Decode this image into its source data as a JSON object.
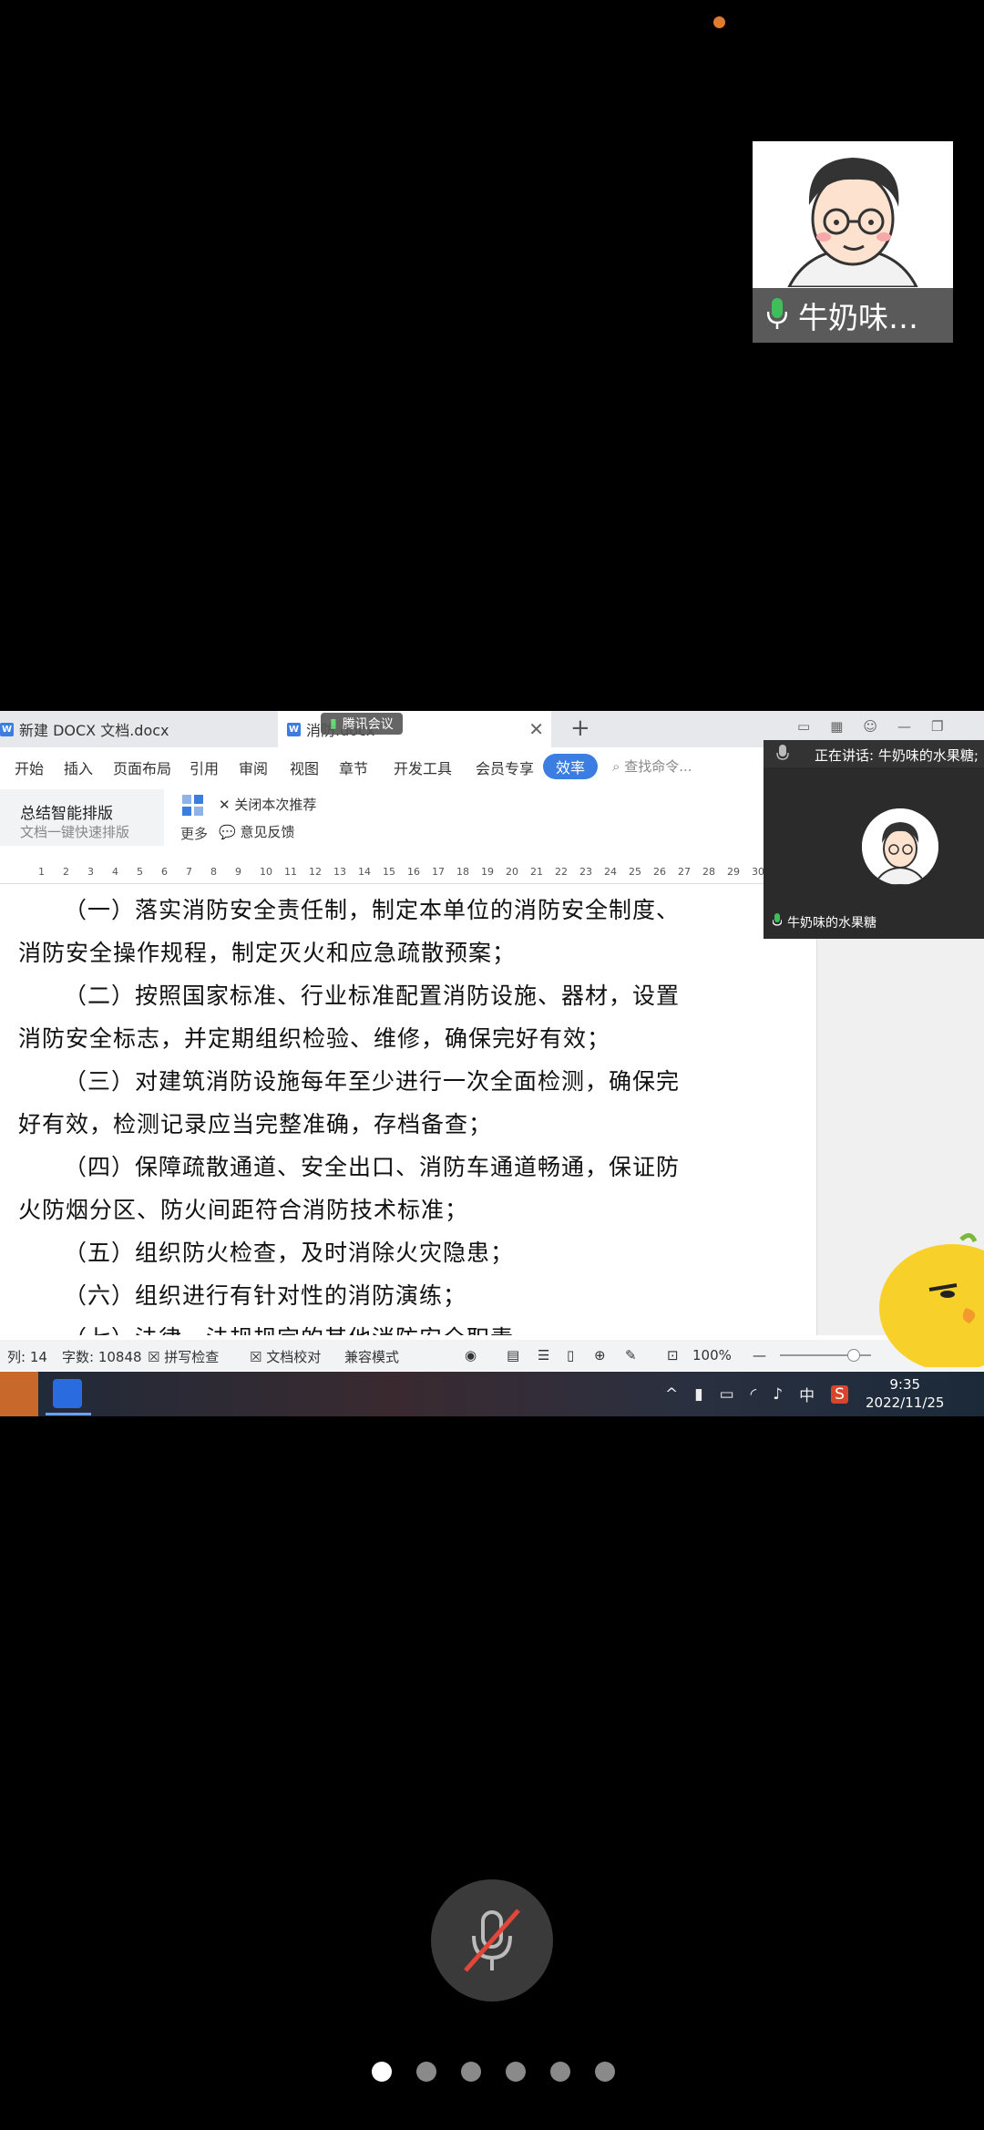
{
  "participant_self": {
    "name": "牛奶味…"
  },
  "screen_share": {
    "tabs": [
      {
        "label": "新建 DOCX 文档.docx"
      },
      {
        "label": "消防.docx"
      }
    ],
    "meeting_pill": "腾讯会议",
    "menu": [
      "开始",
      "插入",
      "页面布局",
      "引用",
      "审阅",
      "视图",
      "章节",
      "开发工具",
      "会员专享",
      "效率"
    ],
    "command_search_placeholder": "查找命令...",
    "ribbon": {
      "smart_title": "总结智能排版",
      "smart_sub": "文档一键快速排版",
      "more": "更多",
      "close_recommend": "关闭本次推荐",
      "feedback": "意见反馈"
    },
    "ruler_ticks": [
      "1",
      "2",
      "3",
      "4",
      "5",
      "6",
      "7",
      "8",
      "9",
      "10",
      "11",
      "12",
      "13",
      "14",
      "15",
      "16",
      "17",
      "18",
      "19",
      "20",
      "21",
      "22",
      "23",
      "24",
      "25",
      "26",
      "27",
      "28",
      "29",
      "30"
    ],
    "paragraphs": [
      "（一）落实消防安全责任制，制定本单位的消防安全制度、",
      "消防安全操作规程，制定灭火和应急疏散预案；",
      "（二）按照国家标准、行业标准配置消防设施、器材，设置",
      "消防安全标志，并定期组织检验、维修，确保完好有效；",
      "（三）对建筑消防设施每年至少进行一次全面检测，确保完",
      "好有效，检测记录应当完整准确，存档备查；",
      "（四）保障疏散通道、安全出口、消防车通道畅通，保证防",
      "火防烟分区、防火间距符合消防技术标准；",
      "（五）组织防火检查，及时消除火灾隐患；",
      "（六）组织进行有针对性的消防演练；",
      "（七）法律、法规规定的其他消防安全职责"
    ],
    "status": {
      "col": "列: 14",
      "word_count": "字数: 10848",
      "spell_check": "拼写检查",
      "doc_proof": "文档校对",
      "compat": "兼容模式",
      "zoom": "100%"
    },
    "clock": {
      "time": "9:35",
      "date": "2022/11/25"
    },
    "tray_ime": "中"
  },
  "speaker_panel": {
    "header": "正在讲话: 牛奶味的水果糖;",
    "name": "牛奶味的水果糖"
  },
  "pager": {
    "count": 6,
    "active": 0
  },
  "colors": {
    "accent": "#3b7de0",
    "rec_dot": "#e07a2c"
  }
}
